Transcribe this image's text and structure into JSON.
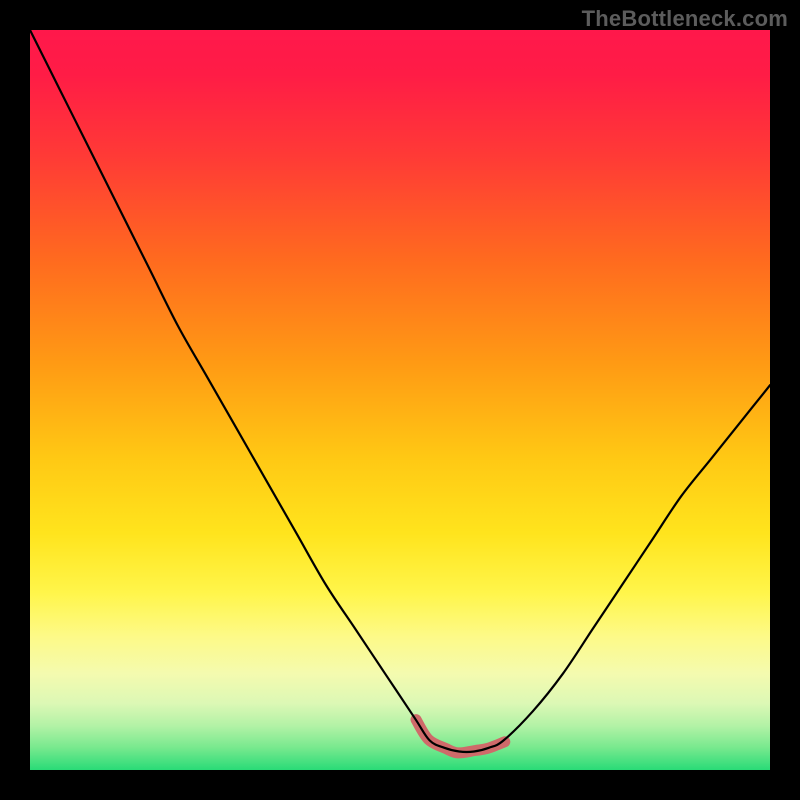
{
  "watermark": "TheBottleneck.com",
  "chart_data": {
    "type": "line",
    "title": "",
    "xlabel": "",
    "ylabel": "",
    "xlim": [
      0,
      100
    ],
    "ylim": [
      0,
      100
    ],
    "x": [
      0,
      4,
      8,
      12,
      16,
      20,
      24,
      28,
      32,
      36,
      40,
      44,
      48,
      52,
      54,
      56,
      58,
      60,
      62,
      64,
      68,
      72,
      76,
      80,
      84,
      88,
      92,
      96,
      100
    ],
    "values": [
      100,
      92,
      84,
      76,
      68,
      60,
      53,
      46,
      39,
      32,
      25,
      19,
      13,
      7,
      4,
      3,
      2.5,
      2.5,
      3,
      4,
      8,
      13,
      19,
      25,
      31,
      37,
      42,
      47,
      52
    ],
    "series": [
      {
        "name": "bottleneck-curve",
        "x": [
          0,
          4,
          8,
          12,
          16,
          20,
          24,
          28,
          32,
          36,
          40,
          44,
          48,
          52,
          54,
          56,
          58,
          60,
          62,
          64,
          68,
          72,
          76,
          80,
          84,
          88,
          92,
          96,
          100
        ],
        "values": [
          100,
          92,
          84,
          76,
          68,
          60,
          53,
          46,
          39,
          32,
          25,
          19,
          13,
          7,
          4,
          3,
          2.5,
          2.5,
          3,
          4,
          8,
          13,
          19,
          25,
          31,
          37,
          42,
          47,
          52
        ]
      }
    ],
    "accent_range_x": [
      50,
      64
    ],
    "gradient_stops": [
      {
        "offset": 0,
        "color": "#ff184b"
      },
      {
        "offset": 17,
        "color": "#ff3a36"
      },
      {
        "offset": 45,
        "color": "#ff9a14"
      },
      {
        "offset": 68,
        "color": "#ffe41d"
      },
      {
        "offset": 87,
        "color": "#dcf8b5"
      },
      {
        "offset": 100,
        "color": "#29db77"
      }
    ],
    "colors": {
      "curve": "#000000",
      "accent": "#cf6a6a",
      "background": "#000000"
    }
  }
}
